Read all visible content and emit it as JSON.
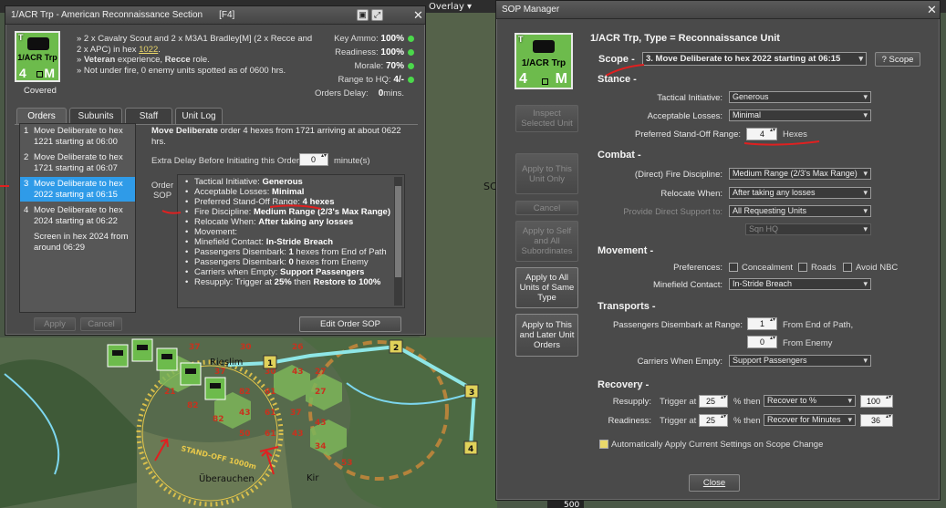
{
  "map": {
    "toolbar_overlay": "Overlay ▾",
    "town_1": "Rieslim",
    "town_2": "Überauchen",
    "town_3": "Kir",
    "standoff_label": "STAND-OFF 1000m",
    "scale_label": "500",
    "waypoints": [
      "1",
      "2",
      "3",
      "4"
    ],
    "hex_numbers": [
      "37",
      "30",
      "26",
      "37",
      "30",
      "21",
      "82",
      "82",
      "61",
      "82",
      "43",
      "61",
      "27",
      "43",
      "37",
      "27",
      "43",
      "43",
      "53",
      "61",
      "34",
      "43",
      "50"
    ],
    "edge_text": "SC"
  },
  "unit_window": {
    "title": "1/ACR Trp - American Reconnaissance Section",
    "hotkey": "[F4]",
    "counter": {
      "type_letter": "T",
      "name": "1/ACR Trp",
      "strength": "4",
      "size": "M"
    },
    "status": "Covered",
    "desc_line1_pre": "» 2 x Cavalry Scout and 2 x M3A1 Bradley[M] (2 x Recce and 2 x APC) in hex ",
    "desc_hex": "1022",
    "desc_line1_post": ".",
    "desc_line2_pre": "» ",
    "desc_line2_bold1": "Veteran",
    "desc_line2_mid": " experience, ",
    "desc_line2_bold2": "Recce",
    "desc_line2_post": " role.",
    "desc_line3": "» Not under fire, 0 enemy units spotted as of 0600 hrs.",
    "stats": [
      {
        "label": "Key Ammo:",
        "value": "100%",
        "dot": true
      },
      {
        "label": "Readiness:",
        "value": "100%",
        "dot": true
      },
      {
        "label": "Morale:",
        "value": "70%",
        "dot": true
      },
      {
        "label": "Range to HQ:",
        "value": "4/-",
        "dot": true
      },
      {
        "label": "Orders Delay:",
        "value": "0",
        "suffix": " mins.",
        "dot": false
      }
    ],
    "tabs": [
      "Orders",
      "Subunits",
      "Staff",
      "Unit Log"
    ],
    "orders": [
      {
        "num": "1",
        "text": "Move Deliberate to hex 1221 starting at 06:00"
      },
      {
        "num": "2",
        "text": "Move Deliberate to hex 1721 starting at 06:07"
      },
      {
        "num": "3",
        "text": "Move Deliberate to hex 2022 starting at 06:15"
      },
      {
        "num": "4",
        "text": "Move Deliberate to hex 2024 starting at 06:22"
      },
      {
        "num": "",
        "text": "Screen in hex 2024 from around 06:29"
      }
    ],
    "order_desc_bold": "Move Deliberate",
    "order_desc_rest": " order 4 hexes from 1721 arriving at about 0622 hrs.",
    "extra_delay_label": "Extra Delay Before Initiating this Order:",
    "extra_delay_value": "0",
    "extra_delay_unit": "minute(s)",
    "order_sop_label_1": "Order",
    "order_sop_label_2": "SOP",
    "sop_items": [
      {
        "k": "Tactical Initiative: ",
        "v": "Generous"
      },
      {
        "k": "Acceptable Losses: ",
        "v": "Minimal"
      },
      {
        "k": "Preferred Stand-Off Range: ",
        "v": "4 hexes"
      },
      {
        "k": "Fire Discipline: ",
        "v": "Medium Range (2/3's Max Range)"
      },
      {
        "k": "Relocate When: ",
        "v": "After taking any losses"
      },
      {
        "k": "Movement:",
        "v": ""
      },
      {
        "k": "Minefield Contact: ",
        "v": "In-Stride Breach"
      },
      {
        "k": "Passengers Disembark: ",
        "v": "1",
        "rest": " hexes from End of Path"
      },
      {
        "k": "Passengers Disembark: ",
        "v": "0",
        "rest": " hexes from Enemy"
      },
      {
        "k": "Carriers when Empty: ",
        "v": "Support Passengers"
      },
      {
        "k": "Resupply: Trigger at ",
        "v": "25%",
        "rest": " then ",
        "v2": "Restore to 100%"
      }
    ],
    "apply": "Apply",
    "cancel": "Cancel",
    "edit_sop": "Edit Order SOP"
  },
  "sop_manager": {
    "title": "SOP Manager",
    "heading": "1/ACR Trp, Type = Reconnaissance Unit",
    "scope_label": "Scope -",
    "scope_value": "3. Move Deliberate to hex 2022 starting at 06:15",
    "scope_help": "? Scope",
    "left_buttons": [
      {
        "label": "Inspect Selected Unit",
        "enabled": false
      },
      {
        "label": "Apply to This Unit Only",
        "enabled": false
      },
      {
        "label": "Cancel",
        "enabled": false
      },
      {
        "label": "Apply to Self and All Subordinates",
        "enabled": false
      },
      {
        "label": "Apply to All Units of Same Type",
        "enabled": true
      },
      {
        "label": "Apply to This and Later Unit Orders",
        "enabled": true
      }
    ],
    "stance": {
      "title": "Stance -",
      "tactical_initiative_label": "Tactical Initiative:",
      "tactical_initiative": "Generous",
      "acceptable_losses_label": "Acceptable Losses:",
      "acceptable_losses": "Minimal",
      "standoff_label": "Preferred Stand-Off Range:",
      "standoff_value": "4",
      "standoff_unit": "Hexes"
    },
    "combat": {
      "title": "Combat -",
      "fire_label": "(Direct) Fire Discipline:",
      "fire": "Medium Range (2/3's Max Range)",
      "relocate_label": "Relocate When:",
      "relocate": "After taking any losses",
      "support_label": "Provide Direct Support to:",
      "support": "All Requesting Units",
      "hq": "Sqn HQ"
    },
    "movement": {
      "title": "Movement -",
      "pref_label": "Preferences:",
      "concealment": "Concealment",
      "roads": "Roads",
      "avoid_nbc": "Avoid NBC",
      "minefield_label": "Minefield Contact:",
      "minefield": "In-Stride Breach"
    },
    "transports": {
      "title": "Transports -",
      "disembark_label": "Passengers Disembark at Range:",
      "disembark_path": "1",
      "path_label": "From End of Path,",
      "disembark_enemy": "0",
      "enemy_label": "From Enemy",
      "carriers_label": "Carriers When Empty:",
      "carriers": "Support Passengers"
    },
    "recovery": {
      "title": "Recovery -",
      "resupply_label": "Resupply:",
      "trigger_label": "Trigger at",
      "resupply_trigger": "25",
      "then_label": "% then",
      "resupply_mode": "Recover to %",
      "resupply_value": "100",
      "readiness_label": "Readiness:",
      "readiness_trigger": "25",
      "readiness_mode": "Recover for Minutes",
      "readiness_value": "36"
    },
    "auto_apply": "Automatically Apply Current Settings on Scope Change",
    "close": "Close"
  },
  "colors": {
    "counter_green": "#6dbb4c",
    "selected_blue": "#2f9be8",
    "annotation_red": "#e02020",
    "route_cyan": "#8ee6e6"
  }
}
